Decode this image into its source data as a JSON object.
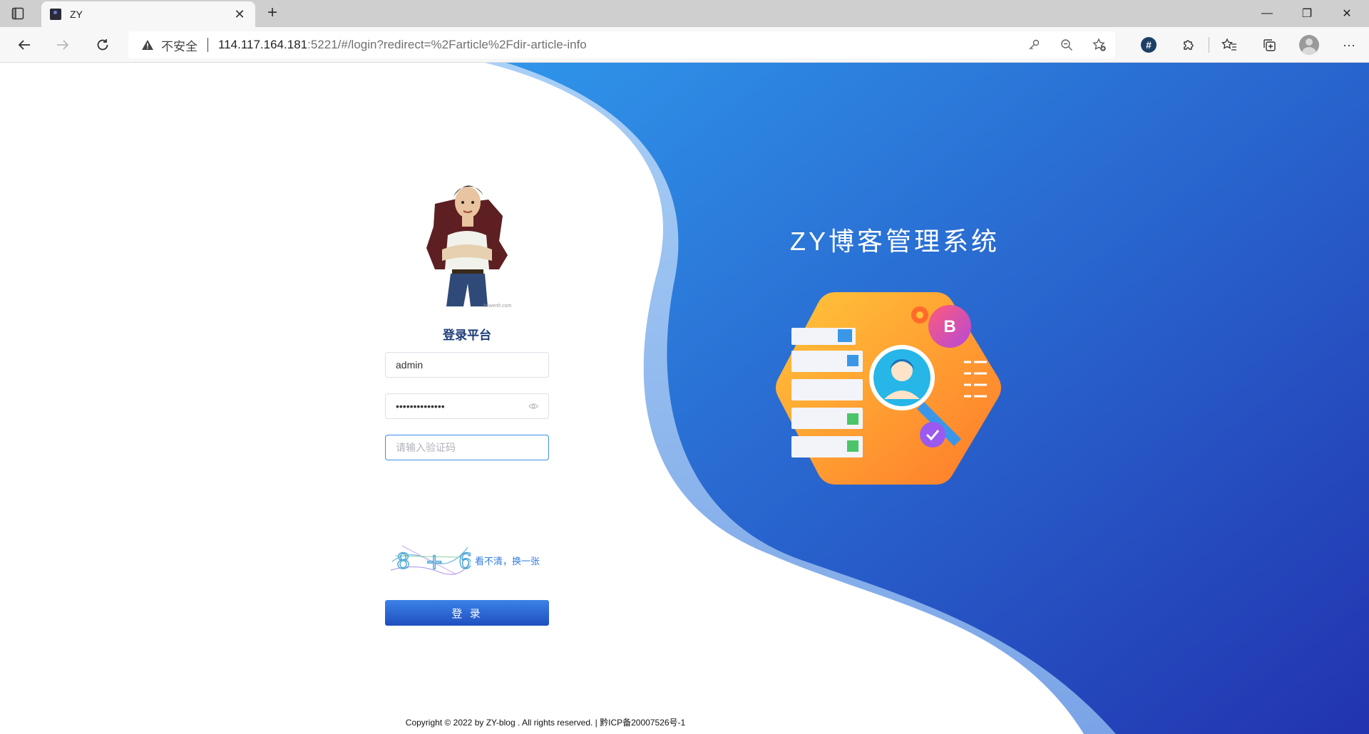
{
  "browser": {
    "tab_title": "ZY",
    "tab_close": "✕",
    "new_tab": "+",
    "insecure_label": "不安全",
    "url_host": "114.117.164.181",
    "url_rest": ":5221/#/login?redirect=%2Farticle%2Fdir-article-info",
    "window_minimize": "—",
    "window_restore": "❐",
    "window_close": "✕",
    "ext_hash_label": "#",
    "more_menu": "···"
  },
  "login": {
    "avatar_watermark": "hxwenh.com",
    "title": "登录平台",
    "username_value": "admin",
    "password_value": "••••••••••••••",
    "captcha_placeholder": "请输入验证码",
    "captcha_text": "8 + 6",
    "captcha_refresh": "看不清，换一张",
    "submit_label": "登 录"
  },
  "hero": {
    "title": "ZY博客管理系统",
    "badge_letter": "B"
  },
  "footer": {
    "copyright": "Copyright © 2022 by ZY-blog . All rights reserved. | 黔ICP备20007526号-1"
  },
  "colors": {
    "accent_blue": "#2c6fe0",
    "wave_light": "#9cc6f5",
    "bg_gradient_start": "#2f95ea",
    "bg_gradient_end": "#2233b0"
  },
  "icons": [
    "sidebar-icon",
    "back-icon",
    "forward-icon",
    "refresh-icon",
    "warning-icon",
    "key-icon",
    "zoom-out-icon",
    "favorite-add-icon",
    "extensions-icon",
    "favorites-icon",
    "collections-icon",
    "profile-icon",
    "more-icon",
    "eye-icon"
  ]
}
